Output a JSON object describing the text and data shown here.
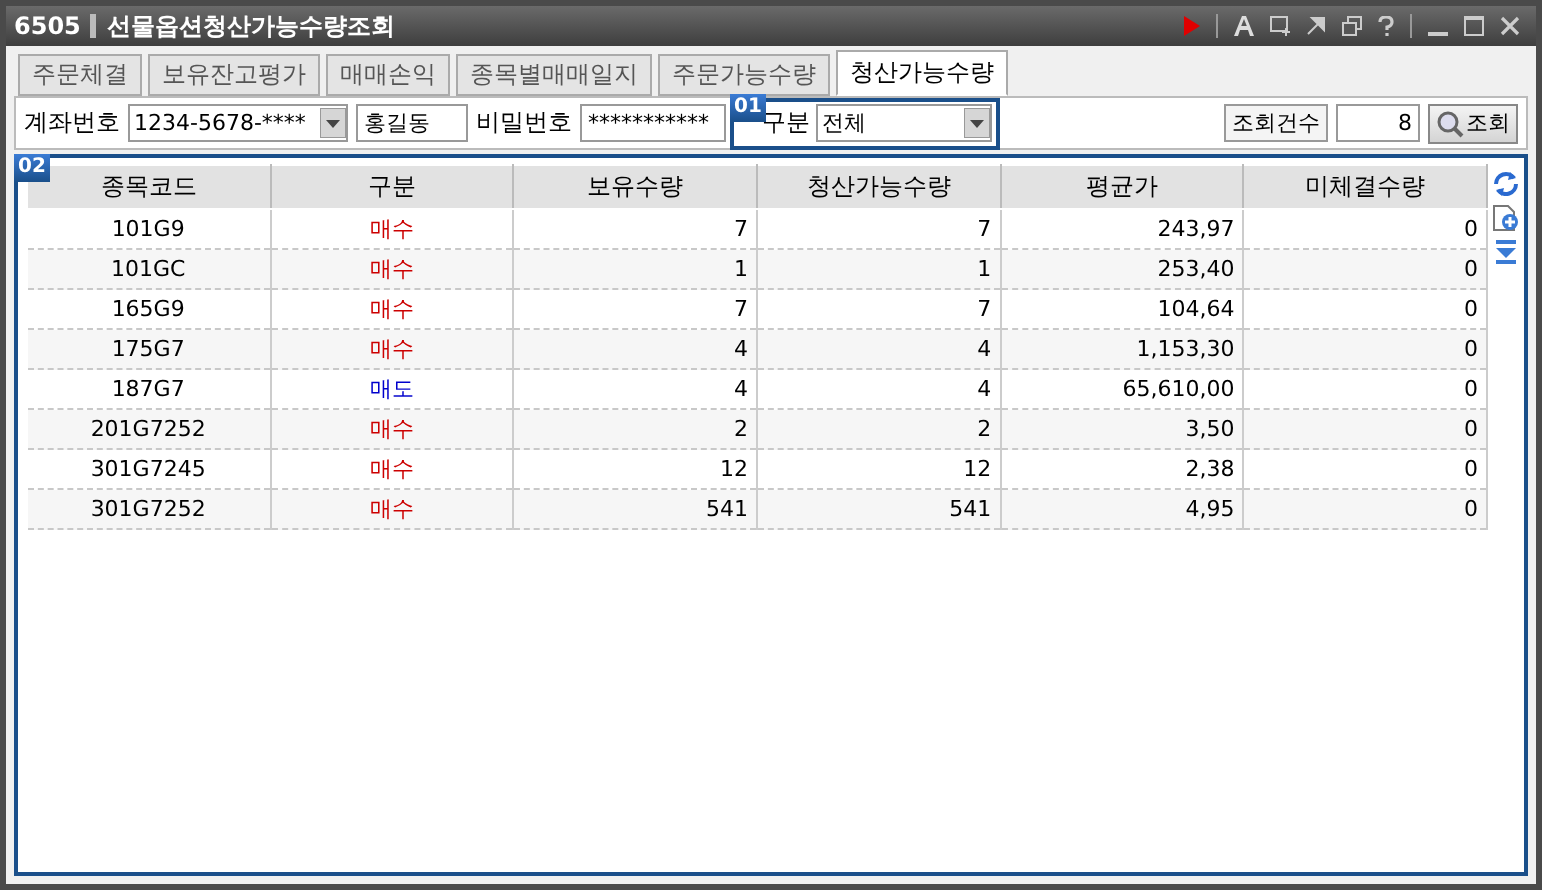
{
  "window": {
    "code": "6505",
    "title": "선물옵션청산가능수량조회"
  },
  "tabs": [
    {
      "label": "주문체결",
      "selected": false
    },
    {
      "label": "보유잔고평가",
      "selected": false
    },
    {
      "label": "매매손익",
      "selected": false
    },
    {
      "label": "종목별매매일지",
      "selected": false
    },
    {
      "label": "주문가능수량",
      "selected": false
    },
    {
      "label": "청산가능수량",
      "selected": true
    }
  ],
  "query": {
    "account_label": "계좌번호",
    "account": "1234-5678-****",
    "owner": "홍길동",
    "password_label": "비밀번호",
    "password": "***********",
    "badge": "01",
    "type_label": "구분",
    "type": "전체",
    "count_label": "조회건수",
    "count": "8",
    "search_button": "조회"
  },
  "table": {
    "badge": "02",
    "columns": [
      "종목코드",
      "구분",
      "보유수량",
      "청산가능수량",
      "평균가",
      "미체결수량"
    ],
    "rows": [
      {
        "code": "101G9",
        "side": "매수",
        "kind": "buy",
        "held": "7",
        "closable": "7",
        "avg": "243,97",
        "unfilled": "0"
      },
      {
        "code": "101GC",
        "side": "매수",
        "kind": "buy",
        "held": "1",
        "closable": "1",
        "avg": "253,40",
        "unfilled": "0"
      },
      {
        "code": "165G9",
        "side": "매수",
        "kind": "buy",
        "held": "7",
        "closable": "7",
        "avg": "104,64",
        "unfilled": "0"
      },
      {
        "code": "175G7",
        "side": "매수",
        "kind": "buy",
        "held": "4",
        "closable": "4",
        "avg": "1,153,30",
        "unfilled": "0"
      },
      {
        "code": "187G7",
        "side": "매도",
        "kind": "sell",
        "held": "4",
        "closable": "4",
        "avg": "65,610,00",
        "unfilled": "0"
      },
      {
        "code": "201G7252",
        "side": "매수",
        "kind": "buy",
        "held": "2",
        "closable": "2",
        "avg": "3,50",
        "unfilled": "0"
      },
      {
        "code": "301G7245",
        "side": "매수",
        "kind": "buy",
        "held": "12",
        "closable": "12",
        "avg": "2,38",
        "unfilled": "0"
      },
      {
        "code": "301G7252",
        "side": "매수",
        "kind": "buy",
        "held": "541",
        "closable": "541",
        "avg": "4,95",
        "unfilled": "0"
      }
    ]
  }
}
